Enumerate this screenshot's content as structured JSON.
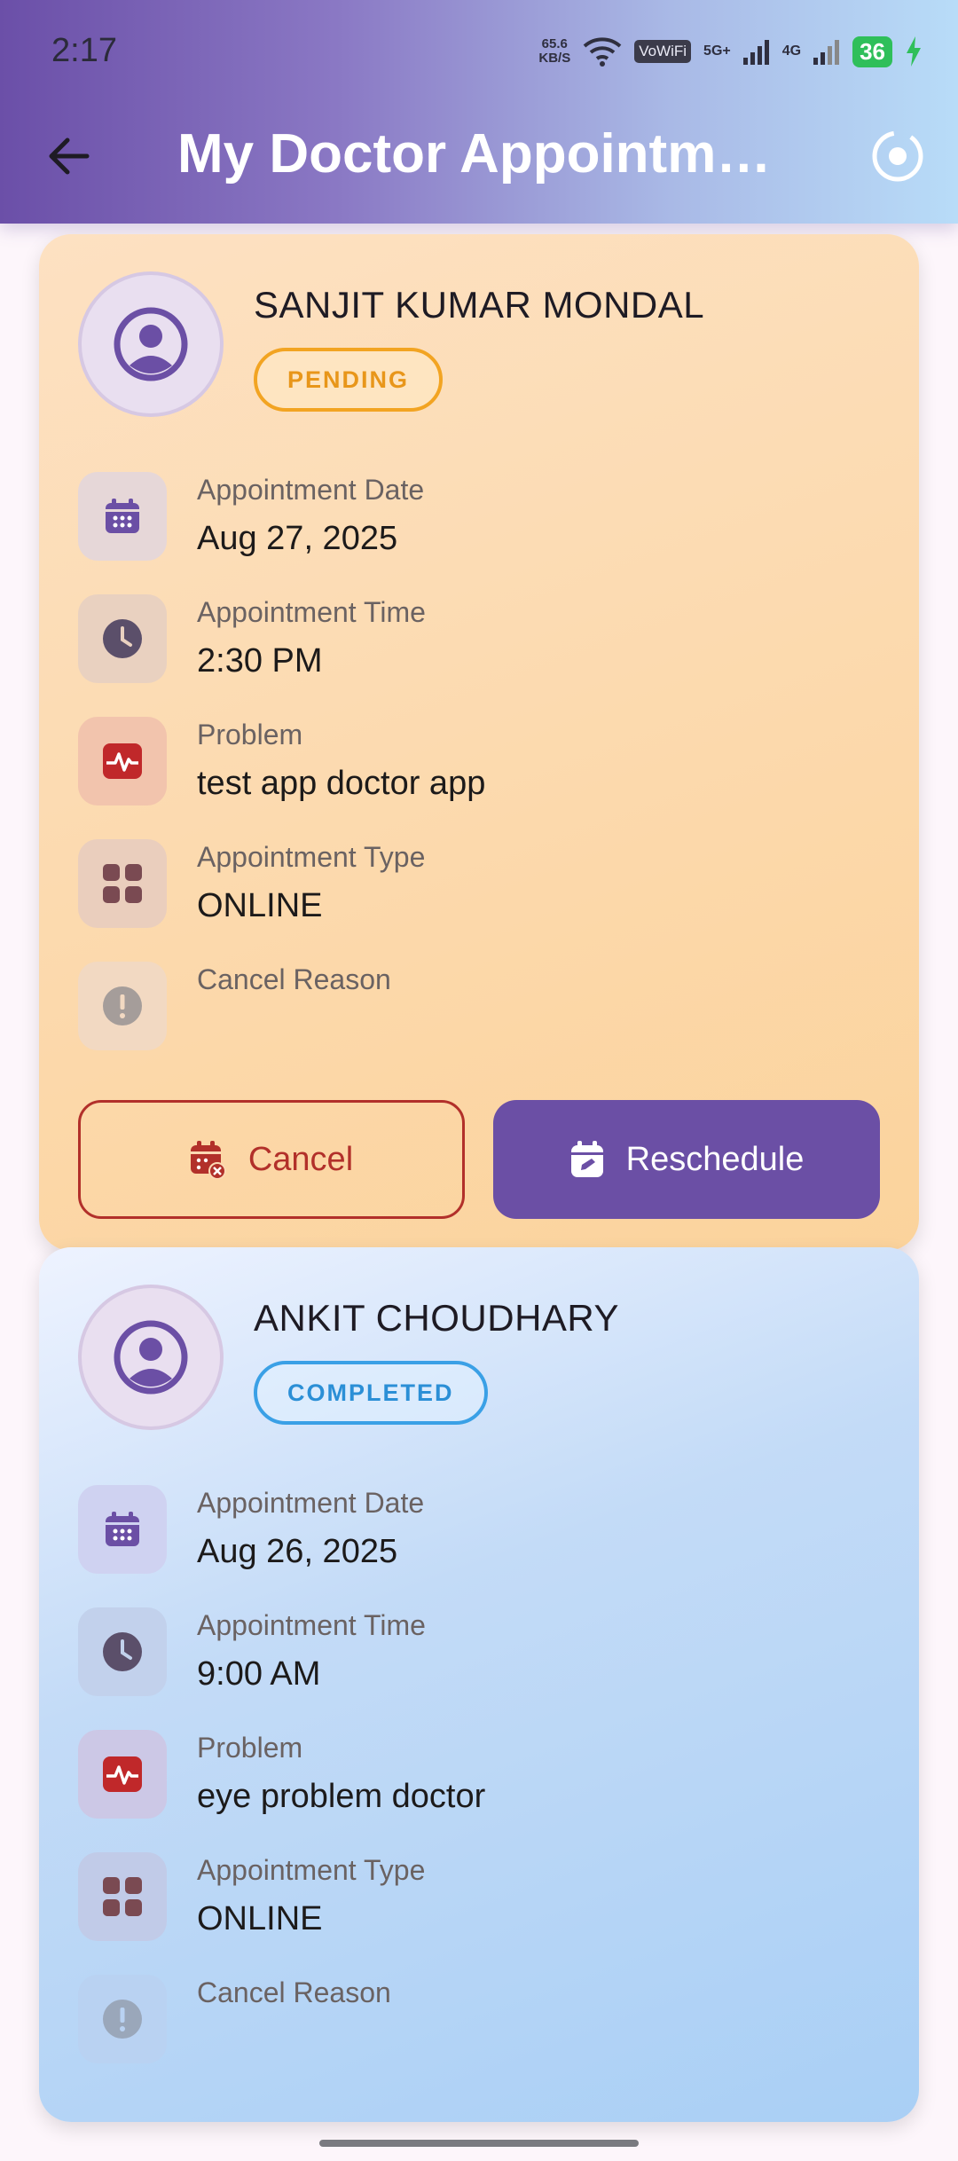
{
  "status_bar": {
    "time": "2:17",
    "net_speed_value": "65.6",
    "net_speed_unit": "KB/S",
    "vowifi": "VoWiFi",
    "sim1_label": "5G+",
    "sim2_label": "4G",
    "battery": "36"
  },
  "header": {
    "title": "My Doctor Appointme…",
    "back_icon": "arrow-left-icon",
    "refresh_icon": "refresh-icon"
  },
  "colors": {
    "header_gradient_start": "#6b4fa8",
    "header_gradient_end": "#b8dcf8",
    "accent_purple": "#6b4fa5",
    "pending_badge": "#f2a422",
    "completed_badge": "#3aa0e6",
    "cancel_red": "#b2302a"
  },
  "appointments": [
    {
      "patient": "SANJIT KUMAR MONDAL",
      "status": "PENDING",
      "date_label": "Appointment Date",
      "date": "Aug 27, 2025",
      "time_label": "Appointment Time",
      "time": "2:30 PM",
      "problem_label": "Problem",
      "problem": "test app doctor app",
      "type_label": "Appointment Type",
      "type": "ONLINE",
      "cancel_reason_label": "Cancel Reason",
      "cancel_reason": "",
      "cancel_button": "Cancel",
      "reschedule_button": "Reschedule"
    },
    {
      "patient": "ANKIT CHOUDHARY",
      "status": "COMPLETED",
      "date_label": "Appointment Date",
      "date": "Aug 26, 2025",
      "time_label": "Appointment Time",
      "time": "9:00 AM",
      "problem_label": "Problem",
      "problem": "eye problem doctor",
      "type_label": "Appointment Type",
      "type": "ONLINE",
      "cancel_reason_label": "Cancel Reason",
      "cancel_reason": ""
    }
  ]
}
